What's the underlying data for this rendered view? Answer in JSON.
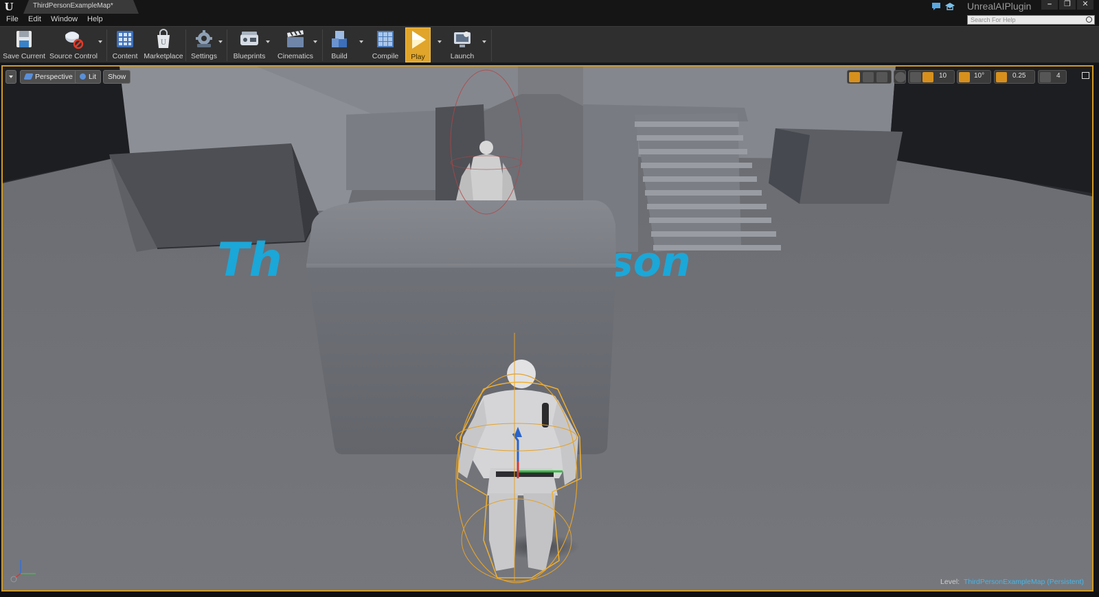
{
  "window": {
    "tab_title": "ThirdPersonExampleMap*",
    "app_name": "UnrealAIPlugin",
    "controls": {
      "minimize": "–",
      "restore": "❐",
      "close": "✕"
    }
  },
  "menu": [
    "File",
    "Edit",
    "Window",
    "Help"
  ],
  "help_search": {
    "placeholder": "Search For Help"
  },
  "toolbar": {
    "save_current": "Save Current",
    "source_control": "Source Control",
    "content": "Content",
    "marketplace": "Marketplace",
    "settings": "Settings",
    "blueprints": "Blueprints",
    "cinematics": "Cinematics",
    "build": "Build",
    "compile": "Compile",
    "play": "Play",
    "launch": "Launch"
  },
  "viewport": {
    "view_mode": "Perspective",
    "lighting": "Lit",
    "show": "Show",
    "snap": {
      "grid": "10",
      "rotation": "10°",
      "scale": "0.25",
      "camera_speed": "4"
    },
    "level_label": "Level:",
    "level_name": "ThirdPersonExampleMap (Persistent)",
    "floor_text_left": "Th",
    "floor_text_right": "son"
  },
  "colors": {
    "accent": "#d19a22",
    "play": "#e0a52a",
    "floor_text": "#1ba7d8",
    "level_name": "#46b6e6",
    "toolbar_bg": "#2f2f2f"
  },
  "icons": {
    "toolbar": [
      "save-icon",
      "source-control-icon",
      "content-icon",
      "marketplace-icon",
      "settings-icon",
      "blueprints-icon",
      "cinematics-icon",
      "build-icon",
      "compile-icon",
      "play-icon",
      "launch-icon"
    ]
  }
}
